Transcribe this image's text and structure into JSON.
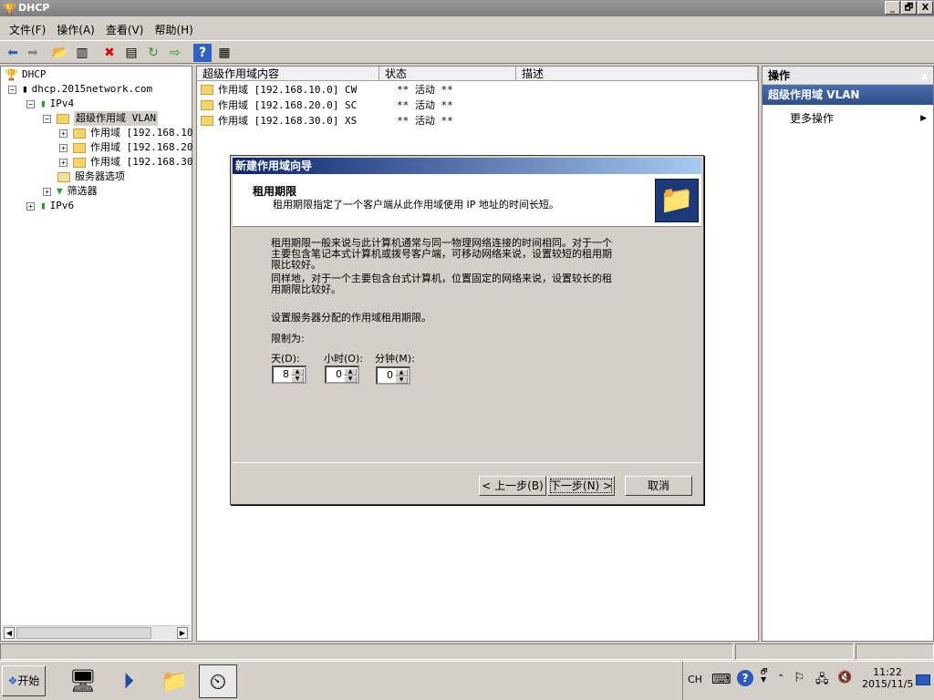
{
  "window": {
    "title": "DHCP",
    "min": "_",
    "max": "🗗",
    "close": "X"
  },
  "menu": [
    "文件(F)",
    "操作(A)",
    "查看(V)",
    "帮助(H)"
  ],
  "tree": {
    "root": "DHCP",
    "server": "dhcp.2015network.com",
    "ipv4": "IPv4",
    "superscope": "超级作用域 VLAN",
    "scopes": [
      "作用域 [192.168.10",
      "作用域 [192.168.20",
      "作用域 [192.168.30"
    ],
    "server_options": "服务器选项",
    "filters": "筛选器",
    "ipv6": "IPv6"
  },
  "list": {
    "columns": [
      "超级作用域内容",
      "状态",
      "描述"
    ],
    "rows": [
      {
        "name": "作用域 [192.168.10.0] CW",
        "status": "** 活动 **"
      },
      {
        "name": "作用域 [192.168.20.0] SC",
        "status": "** 活动 **"
      },
      {
        "name": "作用域 [192.168.30.0] XS",
        "status": "** 活动 **"
      }
    ]
  },
  "actions": {
    "header": "操作",
    "selected": "超级作用域 VLAN",
    "more": "更多操作"
  },
  "dialog": {
    "title": "新建作用域向导",
    "heading": "租用期限",
    "subheading": "租用期限指定了一个客户端从此作用域使用 IP 地址的时间长短。",
    "para1_line1": "租用期限一般来说与此计算机通常与同一物理网络连接的时间相同。对于一个",
    "para1_line2": "主要包含笔记本式计算机或拨号客户端，可移动网络来说，设置较短的租用期",
    "para1_line3": "限比较好。",
    "para2_line1": "同样地，对于一个主要包含台式计算机，位置固定的网络来说，设置较长的租",
    "para2_line2": "用期限比较好。",
    "set_label": "设置服务器分配的作用域租用期限。",
    "limit_label": "限制为:",
    "days_label": "天(D):",
    "hours_label": "小时(O):",
    "minutes_label": "分钟(M):",
    "days": "8",
    "hours": "0",
    "minutes": "0",
    "back": "< 上一步(B)",
    "next": "下一步(N) >",
    "cancel": "取消"
  },
  "taskbar": {
    "start": "开始",
    "lang": "CH",
    "time": "11:22",
    "date": "2015/11/5"
  }
}
